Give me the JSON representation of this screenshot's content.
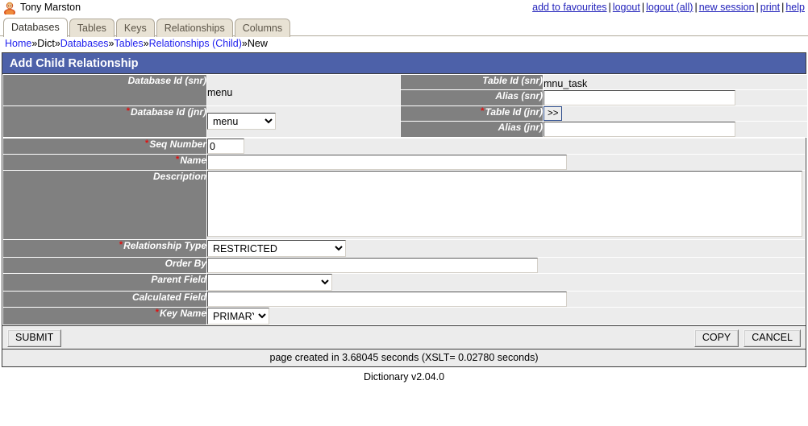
{
  "header": {
    "user_name": "Tony Marston",
    "avatar_icon": "user-avatar-icon",
    "links": [
      {
        "label": "add to favourites"
      },
      {
        "label": "logout"
      },
      {
        "label": "logout (all)"
      },
      {
        "label": "new session"
      },
      {
        "label": "print"
      },
      {
        "label": "help"
      }
    ],
    "separator": "|"
  },
  "tabs": [
    {
      "label": "Databases",
      "active": true
    },
    {
      "label": "Tables",
      "active": false
    },
    {
      "label": "Keys",
      "active": false
    },
    {
      "label": "Relationships",
      "active": false
    },
    {
      "label": "Columns",
      "active": false
    }
  ],
  "breadcrumb": {
    "separator": "»",
    "items": [
      {
        "label": "Home",
        "link": true
      },
      {
        "label": "Dict",
        "link": false
      },
      {
        "label": "Databases",
        "link": true
      },
      {
        "label": "Tables",
        "link": true
      },
      {
        "label": "Relationships (Child)",
        "link": true
      },
      {
        "label": "New",
        "link": false
      }
    ]
  },
  "panel": {
    "title": "Add Child Relationship",
    "title_bg": "#4d61a9"
  },
  "fields": {
    "database_id_snr": {
      "label": "Database Id (snr)",
      "required": false,
      "value": "menu",
      "type": "readonly"
    },
    "table_id_snr": {
      "label": "Table Id (snr)",
      "required": false,
      "value": "mnu_task",
      "type": "readonly"
    },
    "alias_snr": {
      "label": "Alias (snr)",
      "required": false,
      "value": "",
      "placeholder": "",
      "type": "text"
    },
    "database_id_jnr": {
      "label": "Database Id (jnr)",
      "required": true,
      "value": "menu",
      "options": [
        "menu"
      ],
      "type": "select"
    },
    "table_id_jnr": {
      "label": "Table Id (jnr)",
      "required": true,
      "value": "",
      "button_label": ">>",
      "type": "picker"
    },
    "alias_jnr": {
      "label": "Alias (jnr)",
      "required": false,
      "value": "",
      "placeholder": "",
      "type": "text"
    },
    "seq_number": {
      "label": "Seq Number",
      "required": true,
      "value": "0",
      "type": "text"
    },
    "name": {
      "label": "Name",
      "required": true,
      "value": "",
      "placeholder": "",
      "type": "text"
    },
    "description": {
      "label": "Description",
      "required": false,
      "value": "",
      "placeholder": "",
      "type": "textarea"
    },
    "relationship_type": {
      "label": "Relationship Type",
      "required": true,
      "value": "RESTRICTED",
      "options": [
        "RESTRICTED"
      ],
      "type": "select"
    },
    "order_by": {
      "label": "Order By",
      "required": false,
      "value": "",
      "placeholder": "",
      "type": "text"
    },
    "parent_field": {
      "label": "Parent Field",
      "required": false,
      "value": "",
      "options": [
        ""
      ],
      "type": "select"
    },
    "calculated_field": {
      "label": "Calculated Field",
      "required": false,
      "value": "",
      "placeholder": "",
      "type": "text"
    },
    "key_name": {
      "label": "Key Name",
      "required": true,
      "value": "PRIMARY",
      "options": [
        "PRIMARY"
      ],
      "type": "select"
    }
  },
  "actions": {
    "submit": "SUBMIT",
    "copy": "COPY",
    "cancel": "CANCEL"
  },
  "status": {
    "text": "page created in 3.68045 seconds (XSLT= 0.02780 seconds)"
  },
  "footer": {
    "text": "Dictionary v2.04.0"
  },
  "required_marker": "*"
}
